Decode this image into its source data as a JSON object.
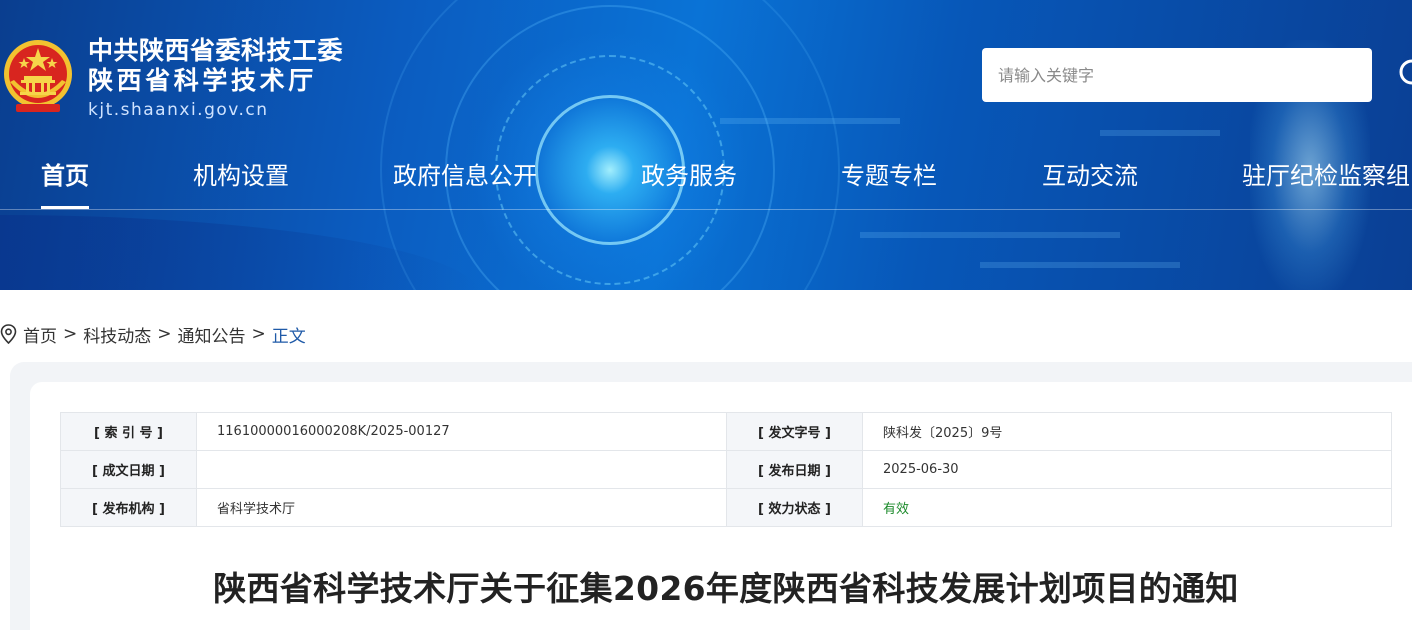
{
  "header": {
    "org_name_line1": "中共陕西省委科技工委",
    "org_name_line2": "陕西省科学技术厅",
    "domain": "kjt.shaanxi.gov.cn",
    "emblem_icon": "national-emblem-icon",
    "accent_color": "#0a5ec2"
  },
  "search": {
    "placeholder": "请输入关键字",
    "value": "",
    "icon": "search-icon"
  },
  "nav": {
    "items": [
      {
        "label": "首页",
        "active": true
      },
      {
        "label": "机构设置",
        "active": false
      },
      {
        "label": "政府信息公开",
        "active": false
      },
      {
        "label": "政务服务",
        "active": false
      },
      {
        "label": "专题专栏",
        "active": false
      },
      {
        "label": "互动交流",
        "active": false
      },
      {
        "label": "驻厅纪检监察组",
        "active": false
      }
    ]
  },
  "breadcrumb": {
    "icon": "location-pin-icon",
    "items": [
      "首页",
      "科技动态",
      "通知公告",
      "正文"
    ],
    "separator": ">"
  },
  "meta": {
    "index_no_label": "[ 索 引 号 ]",
    "index_no": "11610000016000208K/2025-00127",
    "doc_no_label": "[ 发文字号 ]",
    "doc_no": "陕科发〔2025〕9号",
    "created_date_label": "[ 成文日期 ]",
    "created_date": "",
    "publish_date_label": "[ 发布日期 ]",
    "publish_date": "2025-06-30",
    "issuer_label": "[ 发布机构 ]",
    "issuer": "省科学技术厅",
    "status_label": "[ 效力状态 ]",
    "status": "有效",
    "status_color": "#1b8a2a"
  },
  "article": {
    "title": "陕西省科学技术厅关于征集2026年度陕西省科技发展计划项目的通知"
  }
}
